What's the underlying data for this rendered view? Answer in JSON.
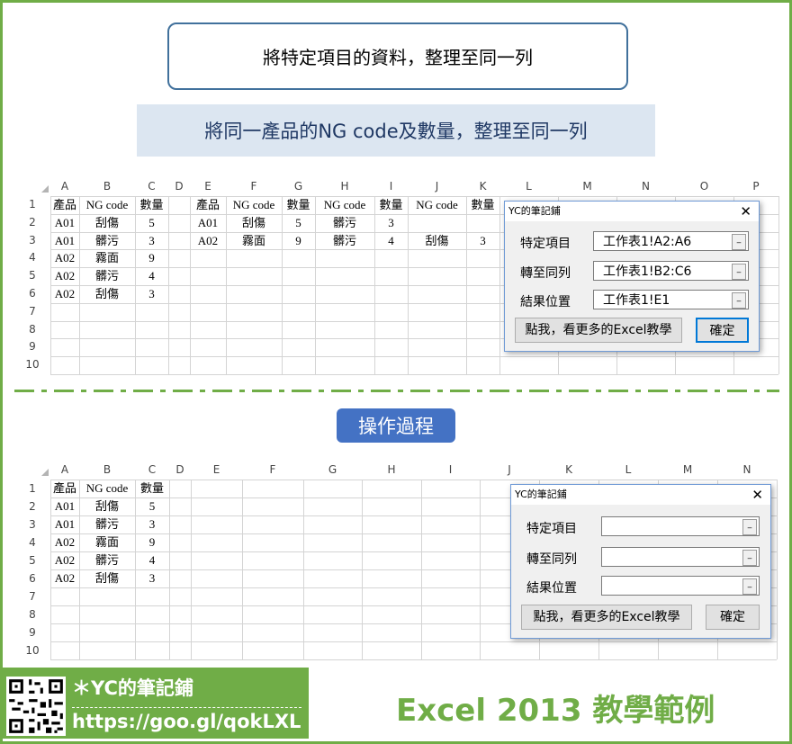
{
  "header": {
    "title": "將特定項目的資料，整理至同一列",
    "subtitle": "將同一產品的NG code及數量，整理至同一列"
  },
  "top_sheet": {
    "columns": [
      "A",
      "B",
      "C",
      "D",
      "E",
      "F",
      "G",
      "H",
      "I",
      "J",
      "K",
      "L",
      "M",
      "N",
      "O",
      "P"
    ],
    "rows": [
      "1",
      "2",
      "3",
      "4",
      "5",
      "6",
      "7",
      "8",
      "9",
      "10"
    ],
    "cells": [
      {
        "r": 1,
        "c": "A",
        "v": "產品"
      },
      {
        "r": 1,
        "c": "B",
        "v": "NG code"
      },
      {
        "r": 1,
        "c": "C",
        "v": "數量"
      },
      {
        "r": 2,
        "c": "A",
        "v": "A01"
      },
      {
        "r": 2,
        "c": "B",
        "v": "刮傷"
      },
      {
        "r": 2,
        "c": "C",
        "v": "5"
      },
      {
        "r": 3,
        "c": "A",
        "v": "A01"
      },
      {
        "r": 3,
        "c": "B",
        "v": "髒污"
      },
      {
        "r": 3,
        "c": "C",
        "v": "3"
      },
      {
        "r": 4,
        "c": "A",
        "v": "A02"
      },
      {
        "r": 4,
        "c": "B",
        "v": "霧面"
      },
      {
        "r": 4,
        "c": "C",
        "v": "9"
      },
      {
        "r": 5,
        "c": "A",
        "v": "A02"
      },
      {
        "r": 5,
        "c": "B",
        "v": "髒污"
      },
      {
        "r": 5,
        "c": "C",
        "v": "4"
      },
      {
        "r": 6,
        "c": "A",
        "v": "A02"
      },
      {
        "r": 6,
        "c": "B",
        "v": "刮傷"
      },
      {
        "r": 6,
        "c": "C",
        "v": "3"
      },
      {
        "r": 1,
        "c": "E",
        "v": "產品"
      },
      {
        "r": 1,
        "c": "F",
        "v": "NG code"
      },
      {
        "r": 1,
        "c": "G",
        "v": "數量"
      },
      {
        "r": 1,
        "c": "H",
        "v": "NG code"
      },
      {
        "r": 1,
        "c": "I",
        "v": "數量"
      },
      {
        "r": 1,
        "c": "J",
        "v": "NG code"
      },
      {
        "r": 1,
        "c": "K",
        "v": "數量"
      },
      {
        "r": 2,
        "c": "E",
        "v": "A01"
      },
      {
        "r": 2,
        "c": "F",
        "v": "刮傷"
      },
      {
        "r": 2,
        "c": "G",
        "v": "5"
      },
      {
        "r": 2,
        "c": "H",
        "v": "髒污"
      },
      {
        "r": 2,
        "c": "I",
        "v": "3"
      },
      {
        "r": 3,
        "c": "E",
        "v": "A02"
      },
      {
        "r": 3,
        "c": "F",
        "v": "霧面"
      },
      {
        "r": 3,
        "c": "G",
        "v": "9"
      },
      {
        "r": 3,
        "c": "H",
        "v": "髒污"
      },
      {
        "r": 3,
        "c": "I",
        "v": "4"
      },
      {
        "r": 3,
        "c": "J",
        "v": "刮傷"
      },
      {
        "r": 3,
        "c": "K",
        "v": "3"
      }
    ]
  },
  "top_dialog": {
    "title": "YC的筆記鋪",
    "close": "✕",
    "label_item": "特定項目",
    "label_row": "轉至同列",
    "label_result": "結果位置",
    "value_item": "工作表1!A2:A6",
    "value_row": "工作表1!B2:C6",
    "value_result": "工作表1!E1",
    "link_button": "點我，看更多的Excel教學",
    "ok_button": "確定"
  },
  "middle": {
    "process_button": "操作過程"
  },
  "bottom_sheet": {
    "columns": [
      "A",
      "B",
      "C",
      "D",
      "E",
      "F",
      "G",
      "H",
      "I",
      "J",
      "K",
      "L",
      "M",
      "N"
    ],
    "rows": [
      "1",
      "2",
      "3",
      "4",
      "5",
      "6",
      "7",
      "8",
      "9",
      "10"
    ],
    "cells": [
      {
        "r": 1,
        "c": "A",
        "v": "產品"
      },
      {
        "r": 1,
        "c": "B",
        "v": "NG code"
      },
      {
        "r": 1,
        "c": "C",
        "v": "數量"
      },
      {
        "r": 2,
        "c": "A",
        "v": "A01"
      },
      {
        "r": 2,
        "c": "B",
        "v": "刮傷"
      },
      {
        "r": 2,
        "c": "C",
        "v": "5"
      },
      {
        "r": 3,
        "c": "A",
        "v": "A01"
      },
      {
        "r": 3,
        "c": "B",
        "v": "髒污"
      },
      {
        "r": 3,
        "c": "C",
        "v": "3"
      },
      {
        "r": 4,
        "c": "A",
        "v": "A02"
      },
      {
        "r": 4,
        "c": "B",
        "v": "霧面"
      },
      {
        "r": 4,
        "c": "C",
        "v": "9"
      },
      {
        "r": 5,
        "c": "A",
        "v": "A02"
      },
      {
        "r": 5,
        "c": "B",
        "v": "髒污"
      },
      {
        "r": 5,
        "c": "C",
        "v": "4"
      },
      {
        "r": 6,
        "c": "A",
        "v": "A02"
      },
      {
        "r": 6,
        "c": "B",
        "v": "刮傷"
      },
      {
        "r": 6,
        "c": "C",
        "v": "3"
      }
    ]
  },
  "bottom_dialog": {
    "title": "YC的筆記鋪",
    "close": "✕",
    "label_item": "特定項目",
    "label_row": "轉至同列",
    "label_result": "結果位置",
    "value_item": "",
    "value_row": "",
    "value_result": "",
    "link_button": "點我，看更多的Excel教學",
    "ok_button": "確定"
  },
  "footer": {
    "brand": "＊YC的筆記鋪",
    "url": "https://goo.gl/qokLXL",
    "title": "Excel 2013 教學範例"
  },
  "colors": {
    "frame_green": "#70ad47",
    "title_border": "#41719c",
    "subtitle_bg": "#dce6f1",
    "process_button_bg": "#4472c4",
    "dash_green": "#70ad47"
  }
}
